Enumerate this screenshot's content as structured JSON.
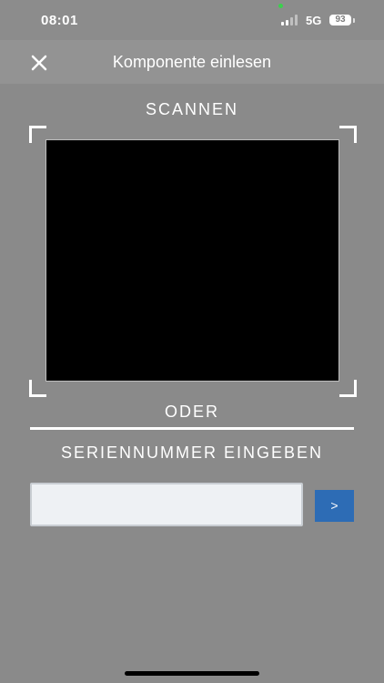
{
  "status_bar": {
    "time": "08:01",
    "network": "5G",
    "battery": "93"
  },
  "header": {
    "title": "Komponente einlesen",
    "close_icon": "close-icon"
  },
  "scan_section": {
    "heading": "SCANNEN"
  },
  "separator": {
    "label": "ODER"
  },
  "serial_section": {
    "heading": "SERIENNUMMER EINGEBEN",
    "input_value": "",
    "input_placeholder": "",
    "submit_label": ">"
  },
  "colors": {
    "background": "#8a8a8a",
    "nav_background": "#939393",
    "camera_view": "#000000",
    "input_background": "#eef1f4",
    "submit_button": "#2d6cb5",
    "signal_dot": "#3ad14c"
  }
}
